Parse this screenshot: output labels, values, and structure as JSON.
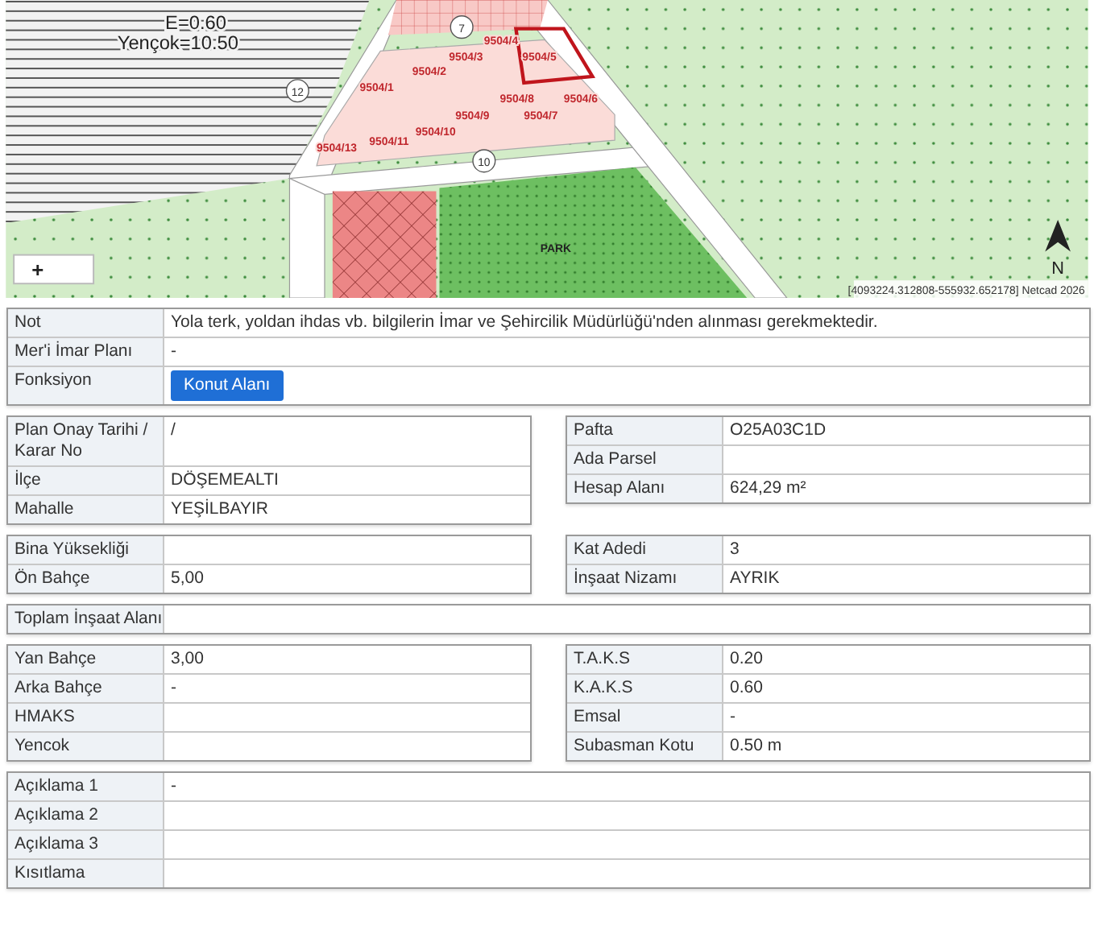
{
  "map": {
    "labels": [
      {
        "text": "E=0.60",
        "kind": "zoning"
      },
      {
        "text": "7",
        "kind": "road"
      },
      {
        "text": "Yençok=10.50",
        "kind": "zoning"
      },
      {
        "text": "9504/4",
        "kind": "parcel"
      },
      {
        "text": "9504/3",
        "kind": "parcel"
      },
      {
        "text": "9504/5",
        "kind": "parcel"
      },
      {
        "text": "9504/2",
        "kind": "parcel"
      },
      {
        "text": "12",
        "kind": "road"
      },
      {
        "text": "9504/1",
        "kind": "parcel"
      },
      {
        "text": "9504/8",
        "kind": "parcel"
      },
      {
        "text": "9504/6",
        "kind": "parcel"
      },
      {
        "text": "9504/9",
        "kind": "parcel"
      },
      {
        "text": "9504/7",
        "kind": "parcel"
      },
      {
        "text": "9504/10",
        "kind": "parcel"
      },
      {
        "text": "9504/11",
        "kind": "parcel"
      },
      {
        "text": "9504/13",
        "kind": "parcel"
      },
      {
        "text": "10",
        "kind": "road"
      },
      {
        "text": "PARK",
        "kind": "area"
      }
    ],
    "zoom_button": "+",
    "north": "N",
    "coordinates": "[4093224.312808-555932.652178] Netcad 2026"
  },
  "sections": [
    {
      "kind": "full",
      "rows": [
        {
          "label": "Not",
          "value": "Yola terk, yoldan ihdas vb. bilgilerin İmar ve Şehircilik Müdürlüğü'nden alınması gerekmektedir."
        },
        {
          "label": "Mer'i İmar Planı",
          "value": "-"
        },
        {
          "label": "Fonksiyon",
          "value": "Konut Alanı",
          "kind": "button"
        }
      ]
    },
    {
      "kind": "split",
      "left": [
        {
          "label": "Plan Onay Tarihi / Karar No",
          "value": "/"
        },
        {
          "label": "İlçe",
          "value": "DÖŞEMEALTI"
        },
        {
          "label": "Mahalle",
          "value": "YEŞİLBAYIR"
        }
      ],
      "right": [
        {
          "label": "Pafta",
          "value": "O25A03C1D"
        },
        {
          "label": "Ada Parsel"
        },
        {
          "label": "Hesap Alanı",
          "value": "624,29 m²"
        }
      ]
    },
    {
      "kind": "split",
      "left": [
        {
          "label": "Bina Yüksekliği"
        },
        {
          "label": "Ön Bahçe",
          "value": "5,00"
        }
      ],
      "right": [
        {
          "label": "Kat Adedi",
          "value": "3"
        },
        {
          "label": "İnşaat Nizamı",
          "value": "AYRIK"
        }
      ]
    },
    {
      "kind": "full",
      "rows": [
        {
          "label": "Toplam İnşaat Alanı"
        }
      ]
    },
    {
      "kind": "split",
      "left": [
        {
          "label": "Yan Bahçe",
          "value": "3,00"
        },
        {
          "label": "Arka Bahçe",
          "value": "-"
        },
        {
          "label": "HMAKS"
        },
        {
          "label": "Yencok"
        }
      ],
      "right": [
        {
          "label": "T.A.K.S",
          "value": "0.20"
        },
        {
          "label": "K.A.K.S",
          "value": "0.60"
        },
        {
          "label": "Emsal",
          "value": "-"
        },
        {
          "label": "Subasman Kotu",
          "value": "0.50 m"
        }
      ]
    },
    {
      "kind": "full",
      "rows": [
        {
          "label": "Açıklama 1",
          "value": "-"
        },
        {
          "label": "Açıklama 2"
        },
        {
          "label": "Açıklama 3"
        },
        {
          "label": "Kısıtlama"
        }
      ]
    }
  ]
}
